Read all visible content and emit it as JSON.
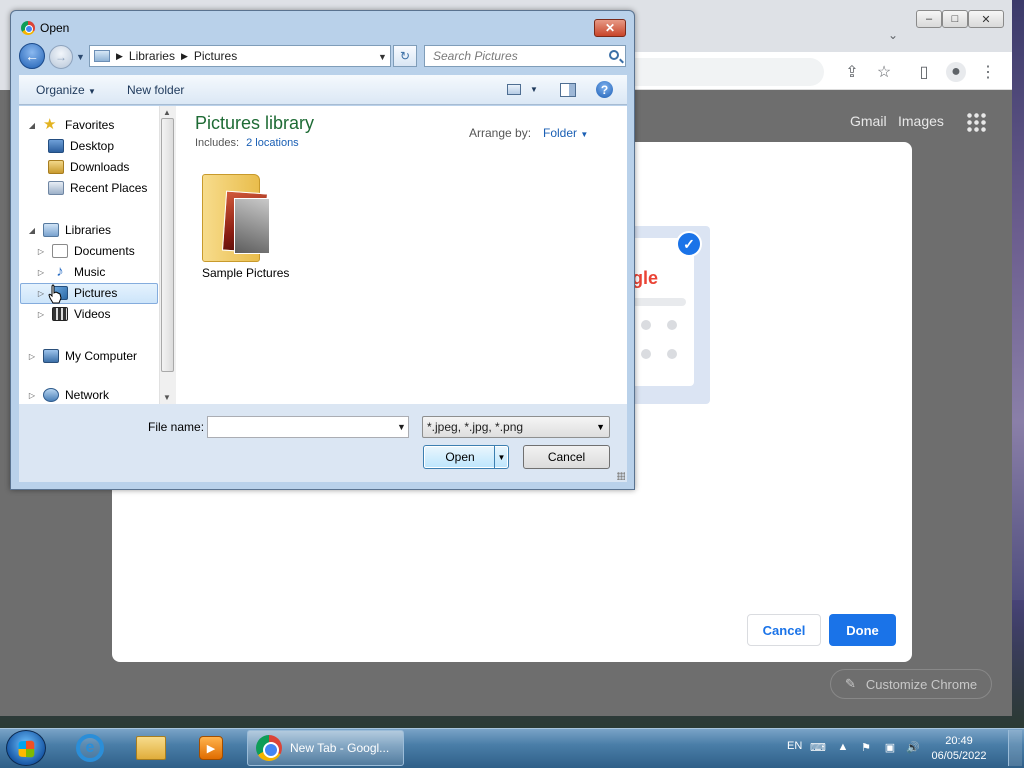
{
  "dialog": {
    "title": "Open",
    "close_label": "✕",
    "breadcrumb": [
      "Libraries",
      "Pictures"
    ],
    "search_placeholder": "Search Pictures",
    "toolbar": {
      "organize": "Organize",
      "new_folder": "New folder"
    },
    "nav": {
      "favorites": "Favorites",
      "desktop": "Desktop",
      "downloads": "Downloads",
      "recent": "Recent Places",
      "libraries": "Libraries",
      "documents": "Documents",
      "music": "Music",
      "pictures": "Pictures",
      "videos": "Videos",
      "computer": "My Computer",
      "network": "Network"
    },
    "library": {
      "title": "Pictures library",
      "includes_label": "Includes:",
      "locations": "2 locations",
      "arrange_label": "Arrange by:",
      "arrange_value": "Folder"
    },
    "items": [
      {
        "name": "Sample Pictures"
      }
    ],
    "file_name_label": "File name:",
    "file_name_value": "",
    "file_type": "*.jpeg, *.jpg, *.png",
    "open_label": "Open",
    "cancel_label": "Cancel"
  },
  "chrome": {
    "links": {
      "gmail": "Gmail",
      "images": "Images"
    },
    "modal": {
      "cancel": "Cancel",
      "done": "Done",
      "partial_logo": "gle"
    },
    "customize": "Customize Chrome"
  },
  "taskbar": {
    "active_window": "New Tab - Googl...",
    "language": "EN",
    "time": "20:49",
    "date": "06/05/2022"
  },
  "icons": {
    "favorites": "star-icon",
    "back": "back-arrow-icon",
    "forward": "forward-arrow-icon",
    "help": "help-icon",
    "search": "search-icon"
  },
  "colors": {
    "accent": "#1a73e8",
    "library_title": "#1e6b35",
    "link": "#1a5fb4"
  }
}
